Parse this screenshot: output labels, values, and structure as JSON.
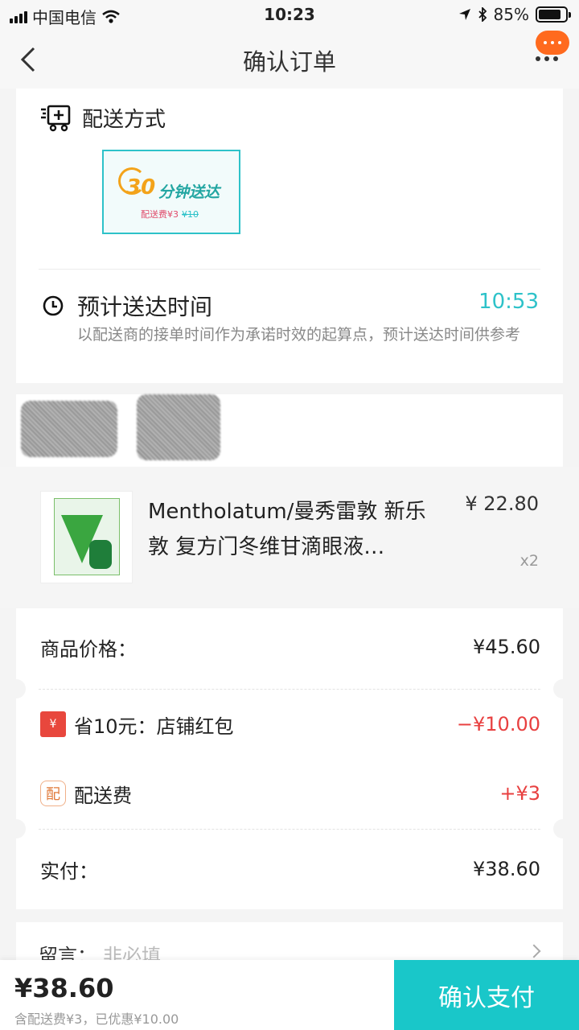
{
  "status_bar": {
    "carrier": "中国电信",
    "time": "10:23",
    "battery": "85%",
    "battery_level": 0.85
  },
  "nav": {
    "title": "确认订单"
  },
  "delivery": {
    "section_title": "配送方式",
    "option": {
      "number": "30",
      "label": "分钟送达",
      "fee_label": "配送费¥3",
      "original_fee": "¥10"
    },
    "eta_title": "预计送达时间",
    "eta_time": "10:53",
    "eta_desc": "以配送商的接单时间作为承诺时效的起算点，预计送达时间供参考"
  },
  "product": {
    "name": "Mentholatum/曼秀雷敦 新乐敦 复方门冬维甘滴眼液…",
    "price": "¥ 22.80",
    "qty": "x2"
  },
  "summary": {
    "goods_label": "商品价格：",
    "goods_value": "¥45.60",
    "redpack_icon": "¥",
    "redpack_label": "省10元：店铺红包",
    "redpack_value": "−¥10.00",
    "shipping_icon": "配",
    "shipping_label": "配送费",
    "shipping_value": "+¥3",
    "paid_label": "实付：",
    "paid_value": "¥38.60"
  },
  "remark": {
    "label": "留言：",
    "placeholder": "非必填"
  },
  "footer": {
    "total": "¥38.60",
    "note": "含配送费¥3，已优惠¥10.00",
    "pay_button": "确认支付"
  },
  "colors": {
    "accent": "#19c7c9",
    "red": "#e84040",
    "orange": "#ff6a1e"
  }
}
